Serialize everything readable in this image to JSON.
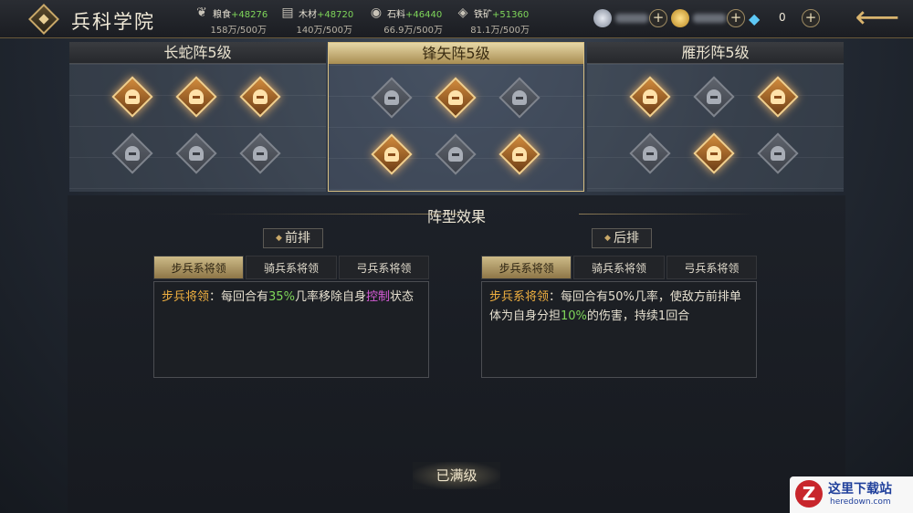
{
  "header": {
    "title": "兵科学院",
    "resources": [
      {
        "icon": "grain-icon",
        "name": "粮食",
        "gain": "+48276",
        "cap": "158万/500万"
      },
      {
        "icon": "wood-icon",
        "name": "木材",
        "gain": "+48720",
        "cap": "140万/500万"
      },
      {
        "icon": "stone-icon",
        "name": "石料",
        "gain": "+46440",
        "cap": "66.9万/500万"
      },
      {
        "icon": "iron-icon",
        "name": "铁矿",
        "gain": "+51360",
        "cap": "81.1万/500万"
      }
    ],
    "gem_count": "0",
    "back_icon": "back-arrow-icon"
  },
  "formations": [
    {
      "name": "长蛇阵5级",
      "active": false,
      "nodes": [
        true,
        true,
        true,
        false,
        false,
        false
      ]
    },
    {
      "name": "锋矢阵5级",
      "active": true,
      "nodes": [
        false,
        true,
        false,
        true,
        false,
        true
      ]
    },
    {
      "name": "雁形阵5级",
      "active": false,
      "nodes": [
        true,
        false,
        true,
        false,
        true,
        false
      ]
    }
  ],
  "effects": {
    "title": "阵型效果",
    "front": {
      "label": "前排",
      "tabs": [
        "步兵系将领",
        "骑兵系将领",
        "弓兵系将领"
      ],
      "selected": 0,
      "desc": {
        "lead": "步兵将领",
        "p1": "：每回合有",
        "v1": "35%",
        "p2": "几率移除自身",
        "v2": "控制",
        "p3": "状态"
      }
    },
    "back": {
      "label": "后排",
      "tabs": [
        "步兵系将领",
        "骑兵系将领",
        "弓兵系将领"
      ],
      "selected": 0,
      "desc": {
        "lead": "步兵系将领",
        "p1": "：每回合有50%几率，使敌方前排单体为自身分担",
        "v1": "10%",
        "p2": "的伤害，持续1回合"
      }
    },
    "max_label": "已满级"
  },
  "watermark": {
    "title": "这里下载站",
    "sub": "heredown.com",
    "logo": "Z"
  },
  "colors": {
    "gold": "#c9a868",
    "green": "#7fd65a",
    "orange": "#f0b040",
    "purple": "#d55bd6"
  }
}
